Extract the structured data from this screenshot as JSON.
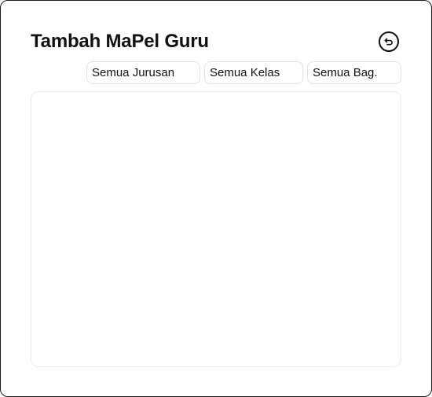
{
  "modal": {
    "title": "Tambah MaPel Guru",
    "back_icon": "undo-arrow-icon"
  },
  "filters": {
    "jurusan": "Semua Jurusan",
    "kelas": "Semua Kelas",
    "bagian": "Semua Bag."
  },
  "colors": {
    "border": "#1a1a1a",
    "text": "#111111",
    "field_border": "#e2e2e2"
  }
}
